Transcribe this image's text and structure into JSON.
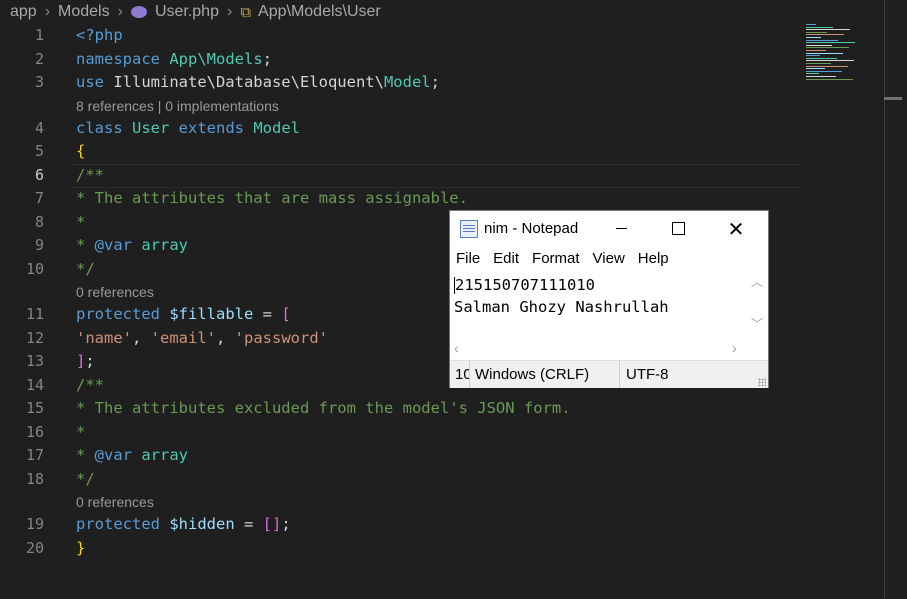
{
  "breadcrumb": {
    "items": [
      "app",
      "Models",
      "User.php",
      "App\\Models\\User"
    ]
  },
  "editor": {
    "active_line": 6,
    "lenses": {
      "before_4": "8 references | 0 implementations",
      "before_11": "0 references",
      "before_19": "0 references"
    },
    "lines": [
      {
        "n": "1",
        "tokens": [
          {
            "t": "<?php",
            "c": "tag"
          }
        ]
      },
      {
        "n": "2",
        "tokens": [
          {
            "t": "namespace ",
            "c": "kw"
          },
          {
            "t": "App\\Models",
            "c": "ns"
          },
          {
            "t": ";",
            "c": "wh"
          }
        ]
      },
      {
        "n": "3",
        "tokens": [
          {
            "t": "use ",
            "c": "kw"
          },
          {
            "t": "Illuminate\\Database\\Eloquent\\",
            "c": "wh"
          },
          {
            "t": "Model",
            "c": "ty"
          },
          {
            "t": ";",
            "c": "wh"
          }
        ]
      },
      {
        "n": "4",
        "tokens": [
          {
            "t": "class ",
            "c": "kw"
          },
          {
            "t": "User ",
            "c": "ty"
          },
          {
            "t": "extends ",
            "c": "kw"
          },
          {
            "t": "Model",
            "c": "ty"
          }
        ]
      },
      {
        "n": "5",
        "tokens": [
          {
            "t": "{",
            "c": "br1"
          }
        ]
      },
      {
        "n": "6",
        "tokens": [
          {
            "t": "/**",
            "c": "cm"
          }
        ]
      },
      {
        "n": "7",
        "tokens": [
          {
            "t": "* The attributes that are mass assignable.",
            "c": "cm"
          }
        ]
      },
      {
        "n": "8",
        "tokens": [
          {
            "t": "*",
            "c": "cm"
          }
        ]
      },
      {
        "n": "9",
        "tokens": [
          {
            "t": "* ",
            "c": "cm"
          },
          {
            "t": "@var ",
            "c": "kw"
          },
          {
            "t": "array",
            "c": "ty"
          }
        ]
      },
      {
        "n": "10",
        "tokens": [
          {
            "t": "*/",
            "c": "cm"
          }
        ]
      },
      {
        "n": "11",
        "tokens": [
          {
            "t": "protected ",
            "c": "kw"
          },
          {
            "t": "$fillable",
            "c": "var"
          },
          {
            "t": " = ",
            "c": "wh"
          },
          {
            "t": "[",
            "c": "br2"
          }
        ]
      },
      {
        "n": "12",
        "tokens": [
          {
            "t": "'name'",
            "c": "str"
          },
          {
            "t": ", ",
            "c": "wh"
          },
          {
            "t": "'email'",
            "c": "str"
          },
          {
            "t": ", ",
            "c": "wh"
          },
          {
            "t": "'password'",
            "c": "str"
          }
        ]
      },
      {
        "n": "13",
        "tokens": [
          {
            "t": "]",
            "c": "br2"
          },
          {
            "t": ";",
            "c": "wh"
          }
        ]
      },
      {
        "n": "14",
        "tokens": [
          {
            "t": "/**",
            "c": "cm"
          }
        ]
      },
      {
        "n": "15",
        "tokens": [
          {
            "t": "* The attributes excluded from the model's JSON form.",
            "c": "cm"
          }
        ]
      },
      {
        "n": "16",
        "tokens": [
          {
            "t": "*",
            "c": "cm"
          }
        ]
      },
      {
        "n": "17",
        "tokens": [
          {
            "t": "* ",
            "c": "cm"
          },
          {
            "t": "@var ",
            "c": "kw"
          },
          {
            "t": "array",
            "c": "ty"
          }
        ]
      },
      {
        "n": "18",
        "tokens": [
          {
            "t": "*/",
            "c": "cm"
          }
        ]
      },
      {
        "n": "19",
        "tokens": [
          {
            "t": "protected ",
            "c": "kw"
          },
          {
            "t": "$hidden",
            "c": "var"
          },
          {
            "t": " = ",
            "c": "wh"
          },
          {
            "t": "[]",
            "c": "br2"
          },
          {
            "t": ";",
            "c": "wh"
          }
        ]
      },
      {
        "n": "20",
        "tokens": [
          {
            "t": "}",
            "c": "br1"
          }
        ]
      }
    ]
  },
  "notepad": {
    "title": "nim - Notepad",
    "menu": [
      "File",
      "Edit",
      "Format",
      "View",
      "Help"
    ],
    "text_lines": [
      "215150707111010",
      "Salman Ghozy Nashrullah"
    ],
    "status": {
      "position": "10",
      "line_ending": "Windows (CRLF)",
      "encoding": "UTF-8"
    }
  },
  "colors": {
    "editor_bg": "#1f1f1f",
    "keyword": "#569cd6",
    "type": "#4ec9b0",
    "comment": "#6a9955",
    "string": "#ce9178",
    "variable": "#9cdcfe"
  }
}
